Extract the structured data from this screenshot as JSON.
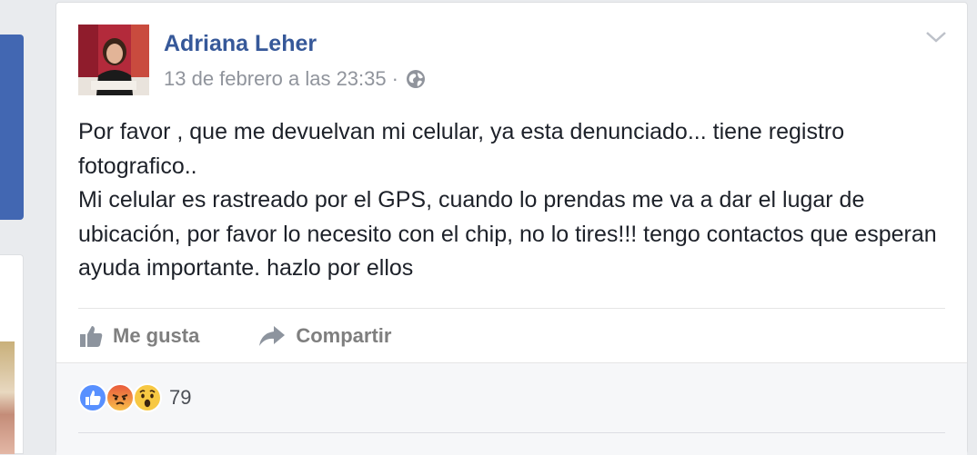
{
  "post": {
    "author": "Adriana Leher",
    "timestamp": "13 de febrero a las 23:35",
    "separator": "·",
    "privacy_icon": "globe-icon",
    "menu_icon": "chevron-down-icon",
    "text_lines": [
      "Por favor , que me devuelvan mi celular, ya esta denunciado... tiene registro fotografico..",
      "Mi celular es rastreado por el GPS, cuando lo prendas me va a dar el lugar de ubicación, por favor lo necesito con el chip, no lo tires!!! tengo contactos que esperan ayuda importante. hazlo por ellos"
    ]
  },
  "actions": {
    "like_label": "Me gusta",
    "share_label": "Compartir"
  },
  "reactions": {
    "icons": [
      "like-reaction-icon",
      "angry-reaction-icon",
      "wow-reaction-icon"
    ],
    "count": "79"
  },
  "colors": {
    "author_link": "#365899",
    "fb_blue": "#4267b2",
    "meta_gray": "#90949c",
    "text": "#1d2129"
  }
}
